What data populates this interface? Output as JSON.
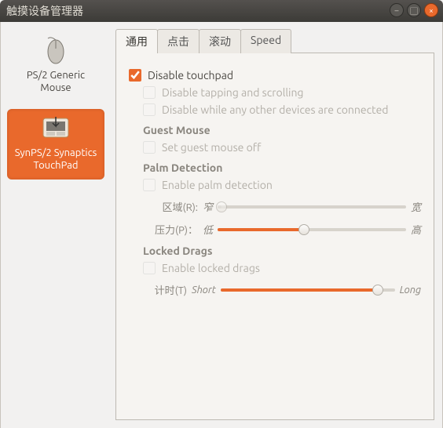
{
  "window": {
    "title": "触摸设备管理器"
  },
  "sidebar": {
    "devices": [
      {
        "name": "PS/2 Generic Mouse",
        "selected": false
      },
      {
        "name": "SynPS/2 Synaptics TouchPad",
        "selected": true
      }
    ]
  },
  "tabs": [
    {
      "label": "通用",
      "active": true
    },
    {
      "label": "点击",
      "active": false
    },
    {
      "label": "滚动",
      "active": false
    },
    {
      "label": "Speed",
      "active": false
    }
  ],
  "general": {
    "disable_touchpad": {
      "label": "Disable touchpad",
      "checked": true
    },
    "disable_tap_scroll": {
      "label": "Disable tapping and scrolling",
      "checked": false,
      "enabled": false
    },
    "disable_while_other": {
      "label": "Disable while any other devices are connected",
      "checked": false,
      "enabled": false
    },
    "guest_mouse": {
      "heading": "Guest Mouse",
      "set_off": {
        "label": "Set guest mouse off",
        "checked": false,
        "enabled": false
      }
    },
    "palm": {
      "heading": "Palm Detection",
      "enable": {
        "label": "Enable palm detection",
        "checked": false,
        "enabled": false
      },
      "area": {
        "label": "区域(R):",
        "min_label": "窄",
        "max_label": "宽",
        "value_pct": 2,
        "enabled": false
      },
      "pressure": {
        "label": "压力(P)：",
        "min_label": "低",
        "max_label": "高",
        "value_pct": 46,
        "enabled": true
      }
    },
    "locked_drags": {
      "heading": "Locked Drags",
      "enable": {
        "label": "Enable locked drags",
        "checked": false,
        "enabled": false
      },
      "timer": {
        "label": "计时(T)",
        "min_label": "Short",
        "max_label": "Long",
        "value_pct": 90,
        "enabled": true
      }
    }
  }
}
